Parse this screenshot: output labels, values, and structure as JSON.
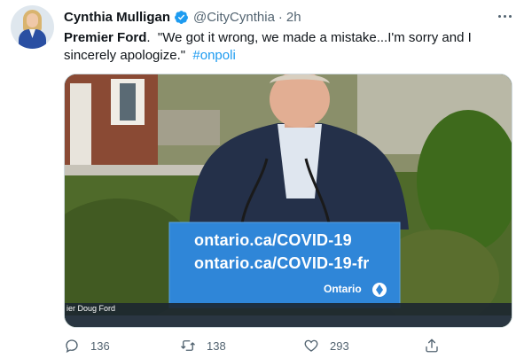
{
  "tweet": {
    "author_name": "Cynthia Mulligan",
    "handle": "@CityCynthia",
    "separator": "·",
    "time": "2h",
    "text_bold": "Premier Ford",
    "text_rest": ".  \"We got it wrong, we made a mistake...I'm sorry and I sincerely apologize.\"  ",
    "hashtag": "#onpoli"
  },
  "media": {
    "podium_line1": "ontario.ca/COVID-19",
    "podium_line2": "ontario.ca/COVID-19-fr",
    "podium_brand": "Ontario",
    "lower_third": "ier Doug Ford"
  },
  "actions": {
    "reply_count": "136",
    "retweet_count": "138",
    "like_count": "293"
  },
  "icons": {
    "verified": "verified-badge-icon",
    "more": "more-options-icon",
    "reply": "reply-icon",
    "retweet": "retweet-icon",
    "like": "heart-icon",
    "share": "share-icon"
  },
  "colors": {
    "accent": "#1d9bf0",
    "secondary_text": "#536471",
    "primary_text": "#0f1419",
    "podium_blue": "#2f86d8"
  }
}
